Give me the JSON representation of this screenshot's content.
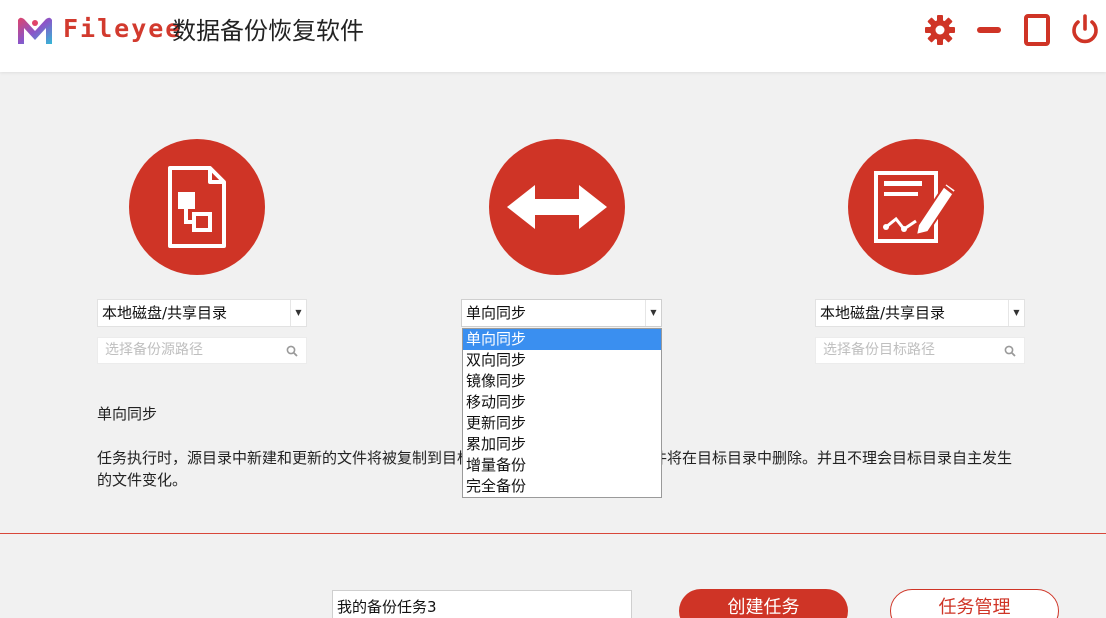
{
  "header": {
    "brand": "Fileyee",
    "title": "数据备份恢复软件",
    "icons": [
      "gear-icon",
      "minimize-icon",
      "maximize-icon",
      "power-icon"
    ]
  },
  "colors": {
    "accent": "#cf3426",
    "selected": "#3a8ff0"
  },
  "source": {
    "icon": "document-flow-icon",
    "type_value": "本地磁盘/共享目录",
    "path_placeholder": "选择备份源路径"
  },
  "mode": {
    "icon": "double-arrow-icon",
    "value": "单向同步",
    "options": [
      "单向同步",
      "双向同步",
      "镜像同步",
      "移动同步",
      "更新同步",
      "累加同步",
      "增量备份",
      "完全备份"
    ],
    "selected_index": 0
  },
  "target": {
    "icon": "edit-document-icon",
    "type_value": "本地磁盘/共享目录",
    "path_placeholder": "选择备份目标路径"
  },
  "description": {
    "title": "单向同步",
    "text": "任务执行时，源目录中新建和更新的文件将被复制到目标目录中，源目录中删除的文件将在目标目录中删除。并且不理会目标目录自主发生的文件变化。"
  },
  "footer": {
    "task_name": "我的备份任务3",
    "create_label": "创建任务",
    "manage_label": "任务管理"
  }
}
